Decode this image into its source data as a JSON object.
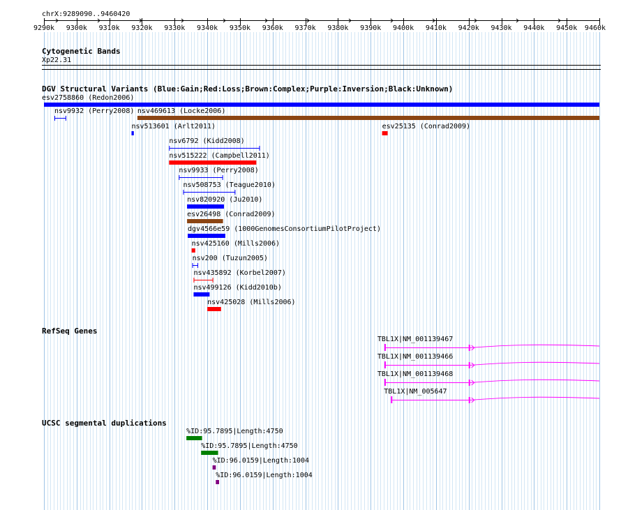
{
  "ruler": {
    "region": "chrX:9289090..9460420",
    "ticks": [
      "9290k",
      "9300k",
      "9310k",
      "9320k",
      "9330k",
      "9340k",
      "9350k",
      "9360k",
      "9370k",
      "9380k",
      "9390k",
      "9400k",
      "9410k",
      "9420k",
      "9430k",
      "9440k",
      "9450k",
      "9460k"
    ]
  },
  "cytoband": {
    "title": "Cytogenetic Bands",
    "band": "Xp22.31"
  },
  "dgv": {
    "title": "DGV Structural Variants (Blue:Gain;Red:Loss;Brown:Complex;Purple:Inversion;Black:Unknown)",
    "colors": {
      "gain": "#0000ff",
      "loss": "#ff0000",
      "complex": "#8b4513",
      "inversion": "#800080",
      "unknown": "#000000"
    },
    "features": [
      {
        "label": "esv2758860 (Redon2006)",
        "start": 9290,
        "end": 9460,
        "kind": "gain",
        "style": "bar"
      },
      {
        "label": "nsv9932 (Perry2008)",
        "start": 9293.2,
        "end": 9296.8,
        "kind": "gain",
        "style": "bracket"
      },
      {
        "label": "nsv469613 (Locke2006)",
        "start": 9318.6,
        "end": 9460,
        "kind": "complex",
        "style": "bar"
      },
      {
        "label": "nsv513601 (Arlt2011)",
        "start": 9316.8,
        "end": 9317.5,
        "kind": "gain",
        "style": "bar"
      },
      {
        "label": "esv25135 (Conrad2009)",
        "start": 9393.5,
        "end": 9395.2,
        "kind": "loss",
        "style": "bar"
      },
      {
        "label": "nsv6792 (Kidd2008)",
        "start": 9328.3,
        "end": 9356.1,
        "kind": "gain",
        "style": "bracket"
      },
      {
        "label": "nsv515222 (Campbell2011)",
        "start": 9328.3,
        "end": 9355.0,
        "kind": "loss",
        "style": "bar"
      },
      {
        "label": "nsv9933 (Perry2008)",
        "start": 9331.3,
        "end": 9344.8,
        "kind": "gain",
        "style": "bracket"
      },
      {
        "label": "nsv508753 (Teague2010)",
        "start": 9332.6,
        "end": 9348.6,
        "kind": "gain",
        "style": "bracket"
      },
      {
        "label": "nsv820920 (Ju2010)",
        "start": 9333.8,
        "end": 9345.1,
        "kind": "gain",
        "style": "bar"
      },
      {
        "label": "esv26498 (Conrad2009)",
        "start": 9333.8,
        "end": 9344.8,
        "kind": "complex",
        "style": "bar"
      },
      {
        "label": "dgv4566e59 (1000GenomesConsortiumPilotProject)",
        "start": 9334.0,
        "end": 9345.5,
        "kind": "gain",
        "style": "bar"
      },
      {
        "label": "nsv425160 (Mills2006)",
        "start": 9335.2,
        "end": 9336.3,
        "kind": "loss",
        "style": "bar"
      },
      {
        "label": "nsv200 (Tuzun2005)",
        "start": 9335.4,
        "end": 9337.2,
        "kind": "gain",
        "style": "bracket"
      },
      {
        "label": "nsv435892 (Korbel2007)",
        "start": 9335.8,
        "end": 9341.8,
        "kind": "loss",
        "style": "bracket"
      },
      {
        "label": "nsv499126 (Kidd2010b)",
        "start": 9335.8,
        "end": 9340.7,
        "kind": "gain",
        "style": "bar"
      },
      {
        "label": "nsv425028 (Mills2006)",
        "start": 9340.0,
        "end": 9344.2,
        "kind": "loss",
        "style": "bar"
      }
    ]
  },
  "refseq": {
    "title": "RefSeq Genes",
    "color": "#ff00ff",
    "genes": [
      {
        "label": "TBL1X|NM_001139467",
        "start": 9394.2,
        "end": 9460
      },
      {
        "label": "TBL1X|NM_001139466",
        "start": 9394.2,
        "end": 9460
      },
      {
        "label": "TBL1X|NM_001139468",
        "start": 9394.2,
        "end": 9460
      },
      {
        "label": "TBL1X|NM_005647",
        "start": 9396.2,
        "end": 9460
      }
    ]
  },
  "segdups": {
    "title": "UCSC segmental duplications",
    "features": [
      {
        "label": "%ID:95.7895|Length:4750",
        "start": 9333.6,
        "end": 9338.4,
        "color": "#008000"
      },
      {
        "label": "%ID:95.7895|Length:4750",
        "start": 9338.1,
        "end": 9343.3,
        "color": "#008000"
      },
      {
        "label": "%ID:96.0159|Length:1004",
        "start": 9341.6,
        "end": 9342.6,
        "color": "#800080"
      },
      {
        "label": "%ID:96.0159|Length:1004",
        "start": 9342.6,
        "end": 9343.6,
        "color": "#800080"
      }
    ]
  }
}
